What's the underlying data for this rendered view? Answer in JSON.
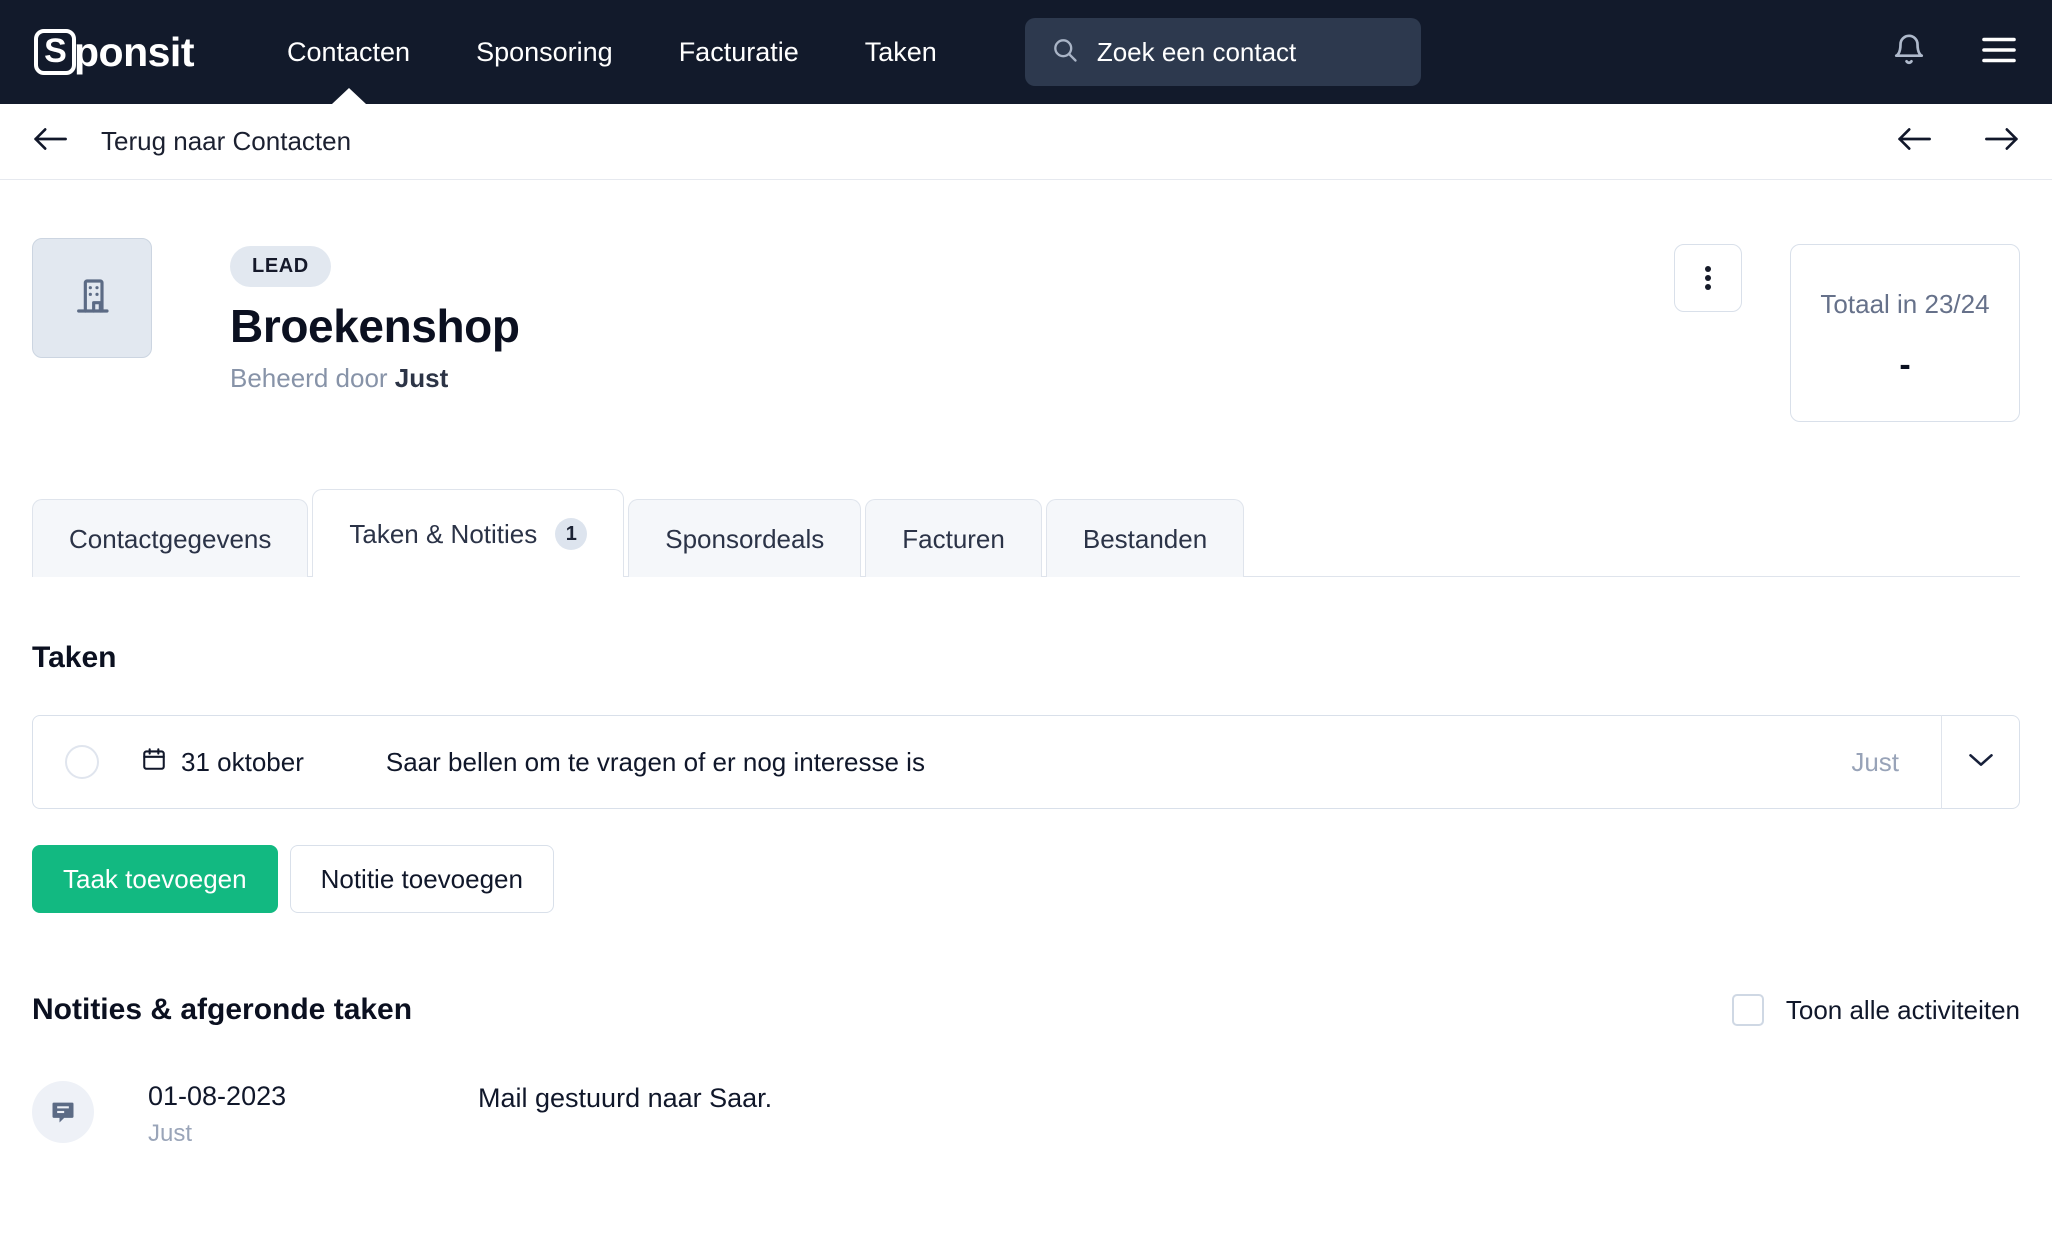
{
  "brand": {
    "logo_mark_letter": "S",
    "logo_word": "ponsit",
    "nav_bg": "#121a2b",
    "accent_green": "#12b981"
  },
  "topnav": {
    "items": [
      {
        "label": "Contacten",
        "active": true
      },
      {
        "label": "Sponsoring",
        "active": false
      },
      {
        "label": "Facturatie",
        "active": false
      },
      {
        "label": "Taken",
        "active": false
      }
    ],
    "search": {
      "placeholder": "Zoek een contact",
      "value": "",
      "icon": "search-icon"
    },
    "notifications_icon": "bell-icon",
    "menu_icon": "hamburger-menu-icon"
  },
  "backbar": {
    "back_icon": "arrow-left-icon",
    "label": "Terug naar Contacten",
    "prev_icon": "arrow-left-icon",
    "next_icon": "arrow-right-icon"
  },
  "entity": {
    "avatar_icon": "building-icon",
    "badge": "LEAD",
    "name": "Broekenshop",
    "managed_by_prefix": "Beheerd door",
    "managed_by": "Just",
    "kebab_icon": "more-vertical-icon",
    "total_card": {
      "label": "Totaal in 23/24",
      "value": "-"
    }
  },
  "tabs": [
    {
      "label": "Contactgegevens",
      "badge": null,
      "active": false
    },
    {
      "label": "Taken & Notities",
      "badge": "1",
      "active": true
    },
    {
      "label": "Sponsordeals",
      "badge": null,
      "active": false
    },
    {
      "label": "Facturen",
      "badge": null,
      "active": false
    },
    {
      "label": "Bestanden",
      "badge": null,
      "active": false
    }
  ],
  "tasks_section": {
    "title": "Taken",
    "rows": [
      {
        "date": "31 oktober",
        "date_icon": "calendar-icon",
        "title": "Saar bellen om te vragen of er nog interesse is",
        "owner": "Just",
        "expand_icon": "chevron-down-icon",
        "checked": false
      }
    ],
    "add_task_label": "Taak toevoegen",
    "add_note_label": "Notitie toevoegen"
  },
  "notes_section": {
    "title": "Notities & afgeronde taken",
    "show_all_label": "Toon alle activiteiten",
    "show_all_checked": false,
    "rows": [
      {
        "icon": "note-comment-icon",
        "date": "01-08-2023",
        "author": "Just",
        "text": "Mail gestuurd naar Saar."
      }
    ]
  }
}
